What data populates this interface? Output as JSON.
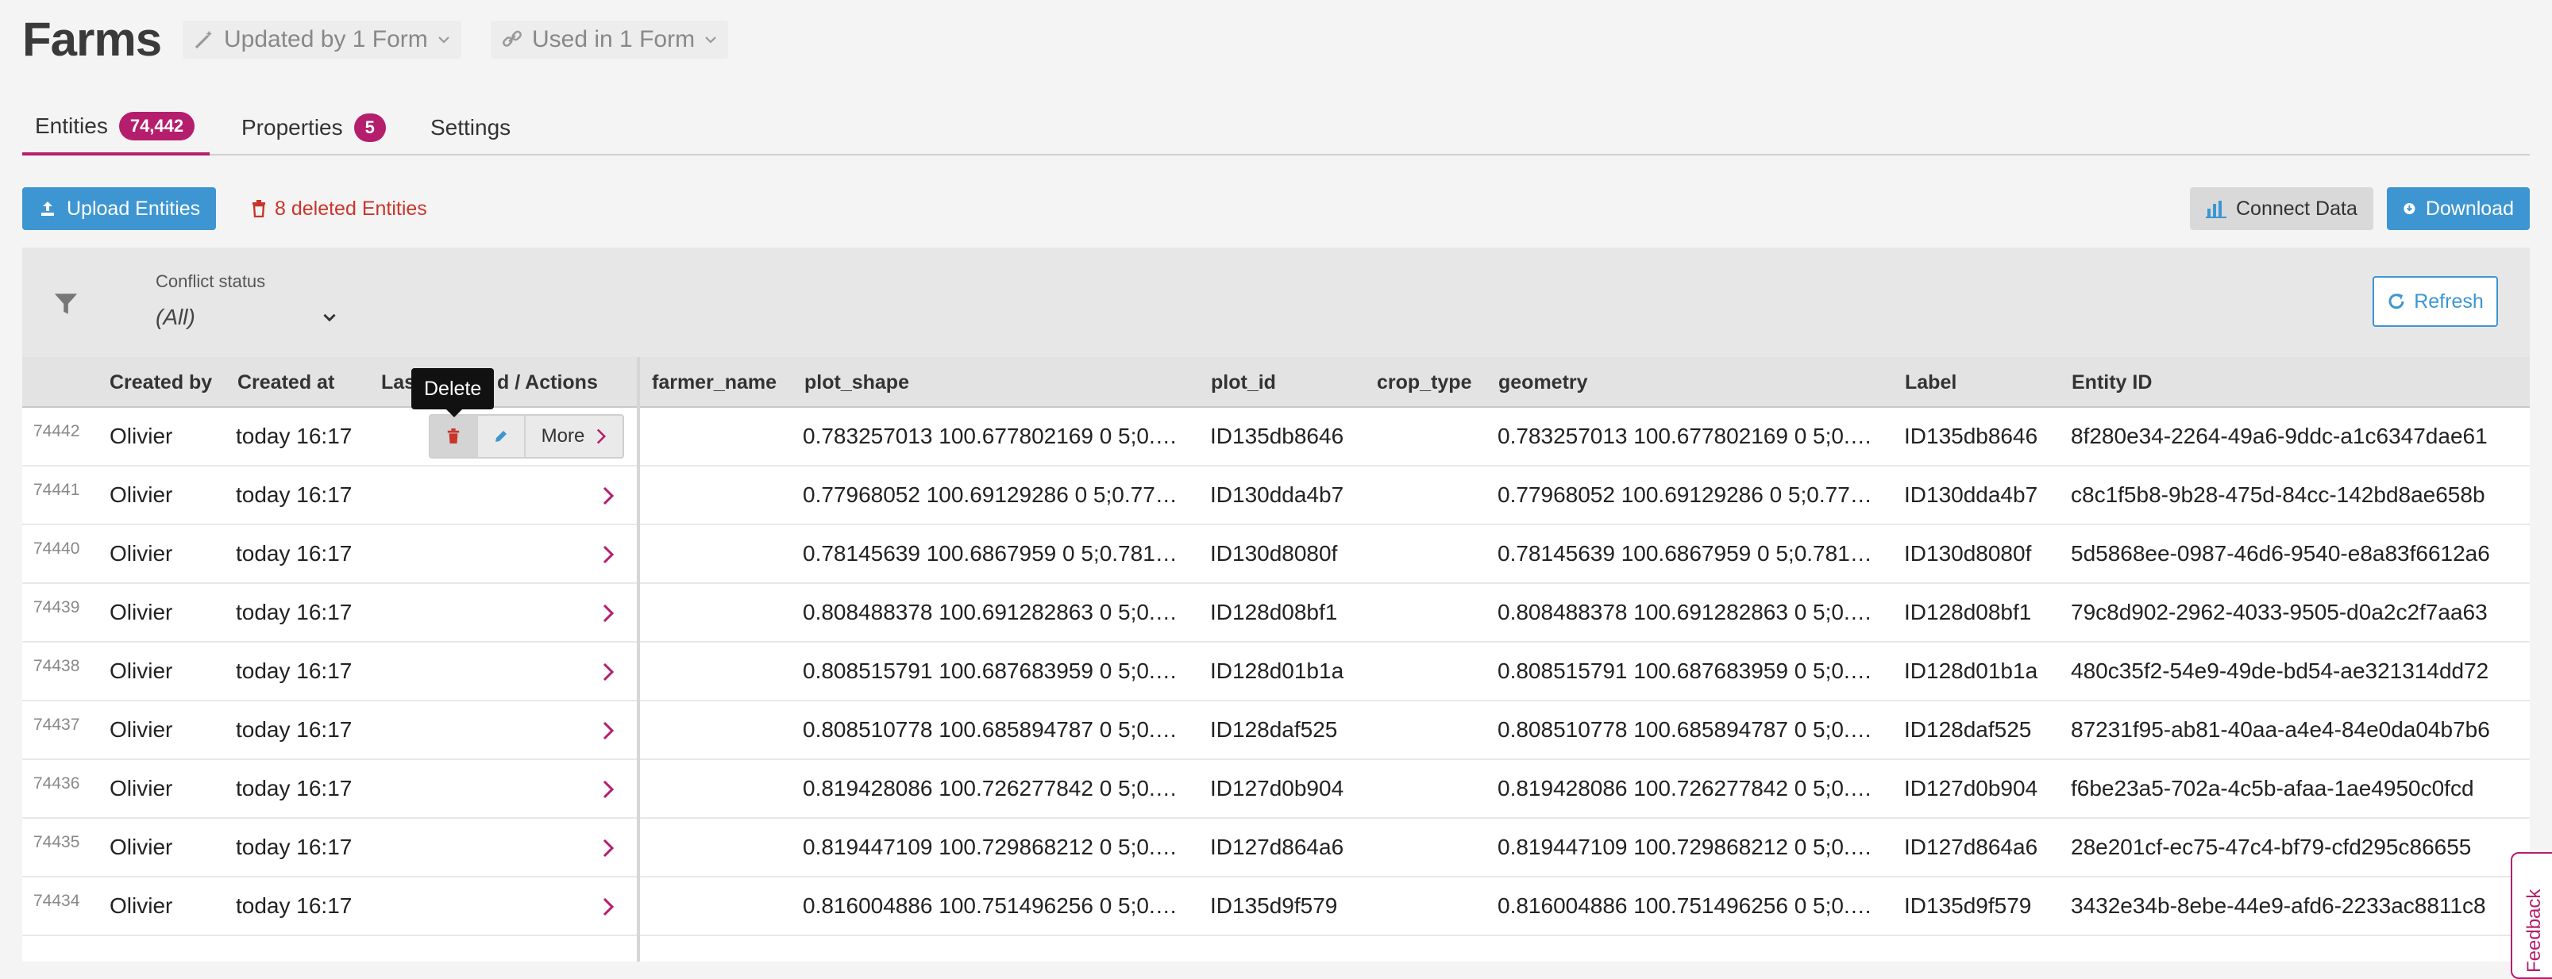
{
  "page": {
    "title": "Farms"
  },
  "header": {
    "updated_by": "Updated by 1 Form",
    "used_in": "Used in 1 Form"
  },
  "tabs": [
    {
      "label": "Entities",
      "badge": "74,442"
    },
    {
      "label": "Properties",
      "badge": "5"
    },
    {
      "label": "Settings"
    }
  ],
  "toolbar": {
    "upload_label": "Upload Entities",
    "deleted_label": "8 deleted Entities",
    "connect_label": "Connect Data",
    "download_label": "Download"
  },
  "filter": {
    "label": "Conflict status",
    "value": "(All)",
    "refresh_label": "Refresh"
  },
  "tooltip": "Delete",
  "actions": {
    "more_label": "More"
  },
  "table": {
    "columns": {
      "created_by": "Created by",
      "created_at": "Created at",
      "last_updated_pre": "Las",
      "last_updated_post": "d / Actions",
      "farmer_name": "farmer_name",
      "plot_shape": "plot_shape",
      "plot_id": "plot_id",
      "crop_type": "crop_type",
      "geometry": "geometry",
      "label": "Label",
      "entity_id": "Entity ID"
    },
    "rows": [
      {
        "num": "74442",
        "created_by": "Olivier",
        "created_at": "today 16:17",
        "plot_shape": "0.783257013 100.677802169 0 5;0.783...",
        "plot_id": "ID135db8646",
        "geometry": "0.783257013 100.677802169 0 5;0.783...",
        "label": "ID135db8646",
        "entity_id": "8f280e34-2264-49a6-9ddc-a1c6347dae61"
      },
      {
        "num": "74441",
        "created_by": "Olivier",
        "created_at": "today 16:17",
        "plot_shape": "0.77968052 100.69129286 0 5;0.7796...",
        "plot_id": "ID130dda4b7",
        "geometry": "0.77968052 100.69129286 0 5;0.7796...",
        "label": "ID130dda4b7",
        "entity_id": "c8c1f5b8-9b28-475d-84cc-142bd8ae658b"
      },
      {
        "num": "74440",
        "created_by": "Olivier",
        "created_at": "today 16:17",
        "plot_shape": "0.78145639 100.6867959 0 5;0.78145...",
        "plot_id": "ID130d8080f",
        "geometry": "0.78145639 100.6867959 0 5;0.78145...",
        "label": "ID130d8080f",
        "entity_id": "5d5868ee-0987-46d6-9540-e8a83f6612a6"
      },
      {
        "num": "74439",
        "created_by": "Olivier",
        "created_at": "today 16:17",
        "plot_shape": "0.808488378 100.691282863 0 5;0.808...",
        "plot_id": "ID128d08bf1",
        "geometry": "0.808488378 100.691282863 0 5;0.808...",
        "label": "ID128d08bf1",
        "entity_id": "79c8d902-2962-4033-9505-d0a2c2f7aa63"
      },
      {
        "num": "74438",
        "created_by": "Olivier",
        "created_at": "today 16:17",
        "plot_shape": "0.808515791 100.687683959 0 5;0.808...",
        "plot_id": "ID128d01b1a",
        "geometry": "0.808515791 100.687683959 0 5;0.808...",
        "label": "ID128d01b1a",
        "entity_id": "480c35f2-54e9-49de-bd54-ae321314dd72"
      },
      {
        "num": "74437",
        "created_by": "Olivier",
        "created_at": "today 16:17",
        "plot_shape": "0.808510778 100.685894787 0 5;0.808...",
        "plot_id": "ID128daf525",
        "geometry": "0.808510778 100.685894787 0 5;0.808...",
        "label": "ID128daf525",
        "entity_id": "87231f95-ab81-40aa-a4e4-84e0da04b7b6"
      },
      {
        "num": "74436",
        "created_by": "Olivier",
        "created_at": "today 16:17",
        "plot_shape": "0.819428086 100.726277842 0 5;0.819...",
        "plot_id": "ID127d0b904",
        "geometry": "0.819428086 100.726277842 0 5;0.819...",
        "label": "ID127d0b904",
        "entity_id": "f6be23a5-702a-4c5b-afaa-1ae4950c0fcd"
      },
      {
        "num": "74435",
        "created_by": "Olivier",
        "created_at": "today 16:17",
        "plot_shape": "0.819447109 100.729868212 0 5;0.819...",
        "plot_id": "ID127d864a6",
        "geometry": "0.819447109 100.729868212 0 5;0.819...",
        "label": "ID127d864a6",
        "entity_id": "28e201cf-ec75-47c4-bf79-cfd295c86655"
      },
      {
        "num": "74434",
        "created_by": "Olivier",
        "created_at": "today 16:17",
        "plot_shape": "0.816004886 100.751496256 0 5;0.816...",
        "plot_id": "ID135d9f579",
        "geometry": "0.816004886 100.751496256 0 5;0.816...",
        "label": "ID135d9f579",
        "entity_id": "3432e34b-8ebe-44e9-afd6-2233ac8811c8"
      }
    ]
  },
  "feedback_label": "Feedback",
  "colors": {
    "accent": "#b51e6c",
    "primary": "#3d96d1",
    "danger": "#c9352a"
  }
}
